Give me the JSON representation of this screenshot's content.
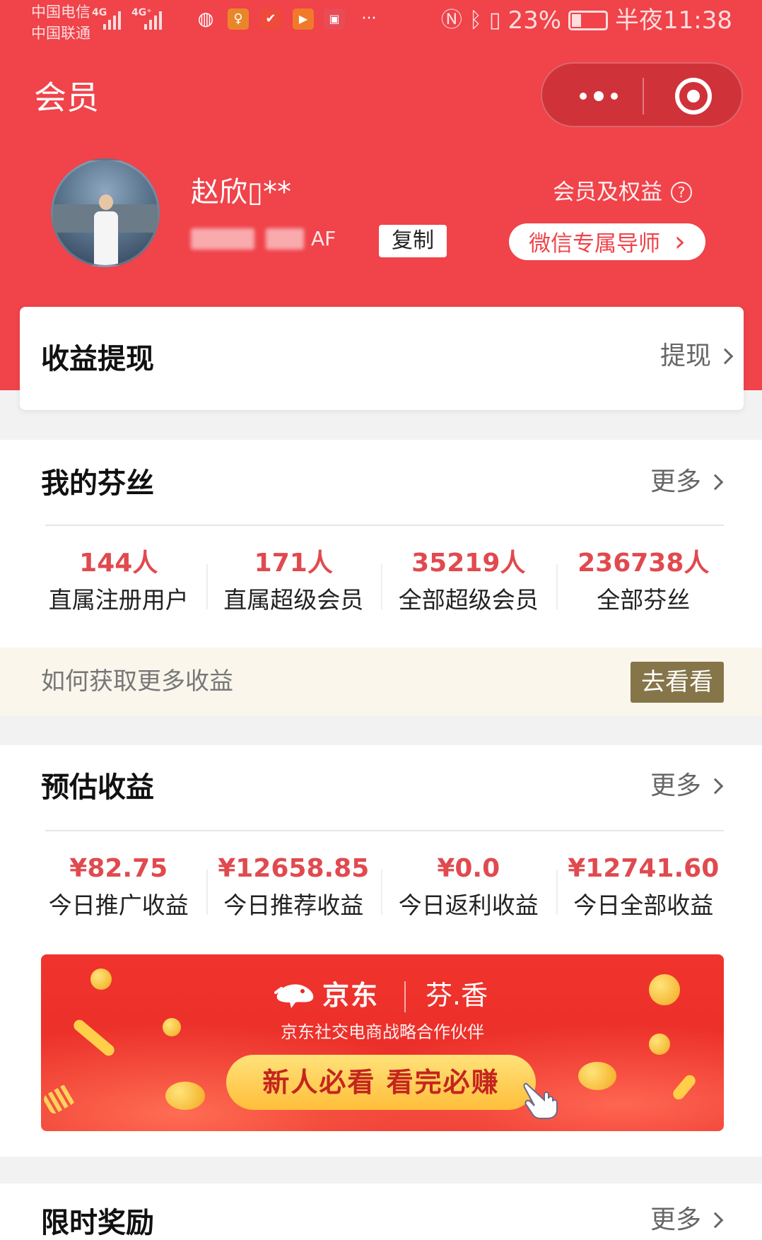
{
  "status_bar": {
    "carrier_1": "中国电信",
    "carrier_2": "中国联通",
    "net_1": "4G",
    "net_2": "4G⁺",
    "more": "···",
    "battery": "23%",
    "time": "半夜11:38",
    "icons": [
      "wechat-icon",
      "app-icon",
      "app-icon",
      "video-icon",
      "app-icon",
      "nfc-icon",
      "bluetooth-icon",
      "vibrate-icon",
      "battery-icon"
    ]
  },
  "nav": {
    "title": "会员"
  },
  "profile": {
    "name": "赵欣▯**",
    "id_suffix": "AF",
    "copy_label": "复制",
    "rights_label": "会员及权益",
    "help_glyph": "?",
    "tutor_label": "微信专属导师",
    "tutor_chevron": "›"
  },
  "withdraw": {
    "title": "收益提现",
    "link": "提现"
  },
  "fans": {
    "title": "我的芬丝",
    "more": "更多",
    "stats": [
      {
        "value": "144人",
        "label": "直属注册用户"
      },
      {
        "value": "171人",
        "label": "直属超级会员"
      },
      {
        "value": "35219人",
        "label": "全部超级会员"
      },
      {
        "value": "236738人",
        "label": "全部芬丝"
      }
    ]
  },
  "tip": {
    "text": "如何获取更多收益",
    "button": "去看看"
  },
  "earnings": {
    "title": "预估收益",
    "more": "更多",
    "stats": [
      {
        "value": "¥82.75",
        "label": "今日推广收益"
      },
      {
        "value": "¥12658.85",
        "label": "今日推荐收益"
      },
      {
        "value": "¥0.0",
        "label": "今日返利收益"
      },
      {
        "value": "¥12741.60",
        "label": "今日全部收益"
      }
    ]
  },
  "banner": {
    "brand": "京东",
    "partner": "芬.香",
    "subtitle": "京东社交电商战略合作伙伴",
    "cta": "新人必看  看完必赚"
  },
  "rewards": {
    "title": "限时奖励",
    "more": "更多"
  },
  "colors": {
    "brand_red": "#f0434a",
    "value_red": "#e04a4f",
    "tip_button": "#857548",
    "tip_bg": "#faf6ec"
  }
}
